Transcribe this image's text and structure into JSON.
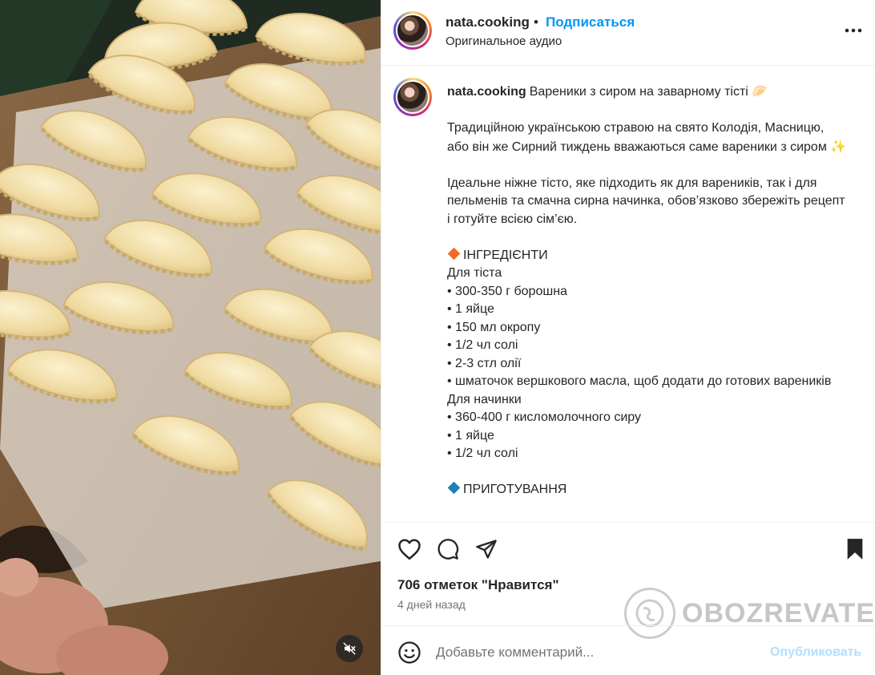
{
  "post": {
    "author": "nata.cooking",
    "separator": "•",
    "follow_label": "Подписаться",
    "audio_label": "Оригинальное аудио",
    "caption": {
      "username": "nata.cooking",
      "title": "Вареники з сиром на заварному тісті",
      "title_emoji": "🥟",
      "para1": "Традиційною українською стравою на свято Колодія, Масницю, або він же Сирний тиждень вважаються саме вареники з сиром",
      "para1_emoji": "✨",
      "para2": "Ідеальне ніжне тісто, яке підходить як для вареників, так і для пельменів та смачна сирна начинка, обов’язково збережіть рецепт і готуйте всією сім’єю.",
      "ingredients_heading": "ІНГРЕДІЄНТИ",
      "dough_heading": "Для тіста",
      "dough_items": [
        "• 300-350 г борошна",
        "• 1 яйце",
        "• 150 мл окропу",
        "• 1/2 чл солі",
        "• 2-3 стл олії",
        "• шматочок вершкового масла, щоб додати до готових вареників"
      ],
      "filling_heading": "Для начинки",
      "filling_items": [
        "• 360-400 г кисломолочного сиру",
        "• 1 яйце",
        "• 1/2 чл солі"
      ],
      "preparation_heading": "ПРИГОТУВАННЯ"
    },
    "likes_text": "706 отметок \"Нравится\"",
    "time_text": "4 дней назад"
  },
  "comment": {
    "placeholder": "Добавьте комментарий...",
    "publish_label": "Опубликовать"
  },
  "watermark_text": "OBOZREVATEL",
  "icons": {
    "like": "heart-icon",
    "comment": "comment-bubble-icon",
    "share": "paper-plane-icon",
    "save": "bookmark-icon",
    "more": "more-dots-icon",
    "mute": "speaker-muted-icon",
    "emoji": "smiley-icon"
  },
  "colors": {
    "link_blue": "#0095f6",
    "publish_disabled": "#b2dffc",
    "ingredients_diamond": "#f26b25",
    "preparation_diamond": "#1f7fb8"
  }
}
